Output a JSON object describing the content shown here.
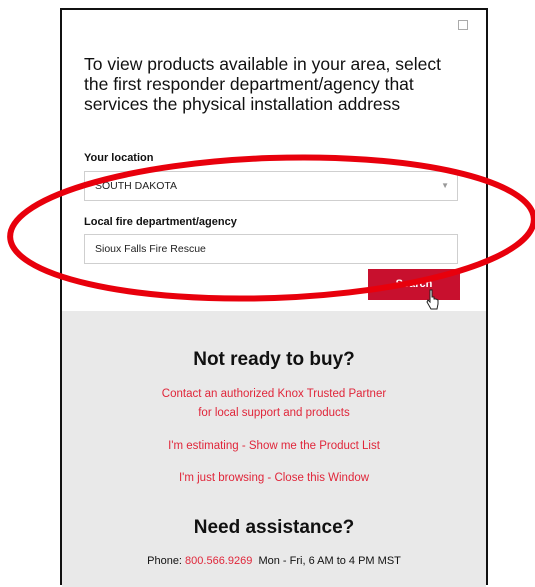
{
  "header": {
    "title": "To view products available in your area, select the first responder department/agency that services the physical installation address"
  },
  "form": {
    "location_label": "Your location",
    "location_value": "SOUTH DAKOTA",
    "agency_label": "Local fire department/agency",
    "agency_value": "Sioux Falls Fire Rescue",
    "search_label": "Search"
  },
  "footer": {
    "not_ready_title": "Not ready to buy?",
    "contact_line1": "Contact an authorized Knox Trusted Partner",
    "contact_line2": "for local support and products",
    "estimating": "I'm estimating - Show me the Product List",
    "browsing": "I'm just browsing - Close this Window",
    "assist_title": "Need assistance?",
    "phone_label": "Phone: ",
    "phone_number": "800.566.9269",
    "hours": "  Mon - Fri, 6 AM to 4 PM MST"
  },
  "colors": {
    "accent": "#c8102e",
    "link": "#e0263a",
    "panel": "#e9e9e9",
    "annotation": "#e8000c"
  },
  "icons": {
    "close": "close-icon",
    "dropdown": "chevron-down-icon",
    "cursor": "hand-cursor-icon"
  }
}
